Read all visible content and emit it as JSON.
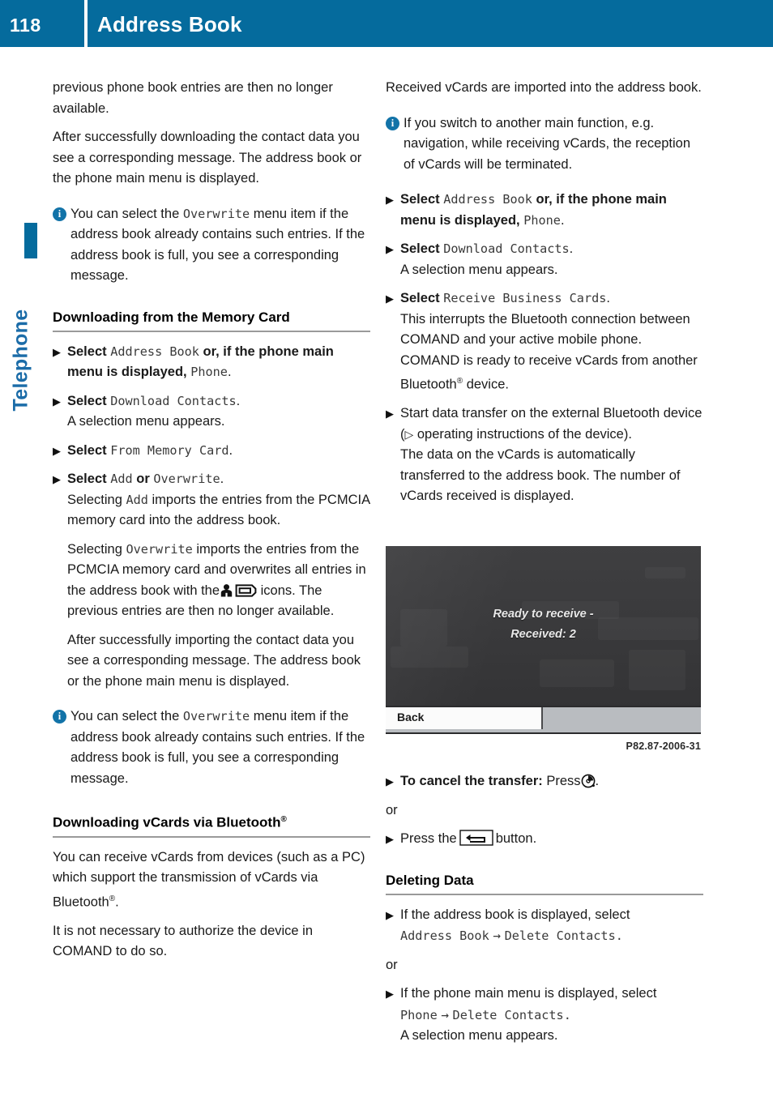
{
  "header": {
    "page_number": "118",
    "title": "Address Book",
    "accent_color": "#056b9d"
  },
  "side_tab": {
    "label": "Telephone",
    "color": "#1b6ca8"
  },
  "left_column": {
    "para_continuation": "previous phone book entries are then no longer available.",
    "para_after_download": "After successfully downloading the contact data you see a corresponding message. The address book or the phone main menu is displayed.",
    "note_overwrite_1": {
      "icon": "info-icon",
      "text_before": "You can select the",
      "menu_item": "Overwrite",
      "text_after": "menu item if the address book already contains such entries. If the address book is full, you see a corresponding message."
    },
    "heading_memory_card": "Downloading from the Memory Card",
    "step_select_address_book": {
      "marker": "triangle-right-icon",
      "lead": "Select",
      "menu_item_1": "Address Book",
      "mid": "or, if the phone main menu is displayed,",
      "menu_item_2": "Phone",
      "tail": "."
    },
    "step_download_contacts": {
      "lead": "Select",
      "menu_item": "Download Contacts",
      "tail": ".",
      "sub": "A selection menu appears."
    },
    "step_from_memory_card": {
      "lead": "Select",
      "menu_item": "From Memory Card",
      "tail": "."
    },
    "step_add_or_overwrite": {
      "lead": "Select",
      "menu_item_1": "Add",
      "mid": "or",
      "menu_item_2": "Overwrite",
      "tail": "."
    },
    "para_selecting_add": {
      "lead": "Selecting",
      "menu_item": "Add",
      "text": "imports the entries from the PCMCIA memory card into the address book."
    },
    "para_selecting_overwrite": {
      "lead": "Selecting",
      "menu_item": "Overwrite",
      "text_1": "imports the entries from the PCMCIA memory card and overwrites all entries in the address book with the",
      "icon_1": "person-icon",
      "icon_2": "memory-card-icon",
      "text_2": "icons. The previous entries are then no longer available."
    },
    "para_after_import": "After successfully importing the contact data you see a corresponding message. The address book or the phone main menu is displayed.",
    "note_overwrite_2": {
      "icon": "info-icon",
      "text_before": "You can select the",
      "menu_item": "Overwrite",
      "text_after": "menu item if the address book already contains such entries. If the address book is full, you see a corresponding message."
    },
    "heading_bluetooth": {
      "text": "Downloading vCards via Bluetooth",
      "registered_mark": "®"
    },
    "para_receive_vcards": {
      "text_1": "You can receive vCards from devices (such as a PC) which support the transmission of vCards via Bluetooth",
      "registered_mark": "®",
      "text_2": "."
    },
    "para_no_authorize": "It is not necessary to authorize the device in COMAND to do so."
  },
  "right_column": {
    "para_received_vcards": "Received vCards are imported into the address book.",
    "note_switch_function": {
      "icon": "info-icon",
      "text": "If you switch to another main function, e.g. navigation, while receiving vCards, the reception of vCards will be terminated."
    },
    "step_select_address_book": {
      "lead": "Select",
      "menu_item_1": "Address Book",
      "mid": "or, if the phone main menu is displayed,",
      "menu_item_2": "Phone",
      "tail": "."
    },
    "step_download_contacts": {
      "lead": "Select",
      "menu_item": "Download Contacts",
      "tail": ".",
      "sub": "A selection menu appears."
    },
    "step_receive_business_cards": {
      "lead": "Select",
      "menu_item": "Receive Business Cards",
      "tail": ".",
      "sub_1": "This interrupts the Bluetooth connection between COMAND and your active mobile phone. COMAND is ready to receive vCards from another Bluetooth",
      "registered_mark": "®",
      "sub_2": "device."
    },
    "step_start_transfer": {
      "text_1": "Start data transfer on the external Bluetooth device (",
      "ref_icon": "triangle-outline-reference-icon",
      "text_2": "operating instructions of the device).",
      "sub": "The data on the vCards is automatically transferred to the address book. The number of vCards received is displayed."
    },
    "step_cancel_transfer": {
      "bold_lead": "To cancel the transfer:",
      "text": "Press",
      "icon": "comand-controller-knob-icon",
      "tail": "."
    },
    "or_label": "or",
    "step_press_back_button": {
      "text_1": "Press the",
      "icon": "back-button-icon",
      "text_2": "button."
    },
    "heading_deleting_data": "Deleting Data",
    "step_address_book_delete": {
      "text": "If the address book is displayed, select",
      "menu_path_1": "Address Book",
      "arrow": "→",
      "menu_path_2": "Delete Contacts",
      "tail": "."
    },
    "or_label_2": "or",
    "step_phone_delete": {
      "text": "If the phone main menu is displayed, select",
      "menu_path_1": "Phone",
      "arrow": "→",
      "menu_path_2": "Delete Contacts",
      "tail": ".",
      "sub": "A selection menu appears."
    }
  },
  "screenshot": {
    "message_line_1": "Ready to receive -",
    "message_line_2": "Received: 2",
    "back_button_label": "Back",
    "caption": "P82.87-2006-31"
  },
  "icons": {
    "step_marker": "▶",
    "reference_triangle": "▷",
    "info_letter": "i",
    "menu_arrow": "→"
  }
}
